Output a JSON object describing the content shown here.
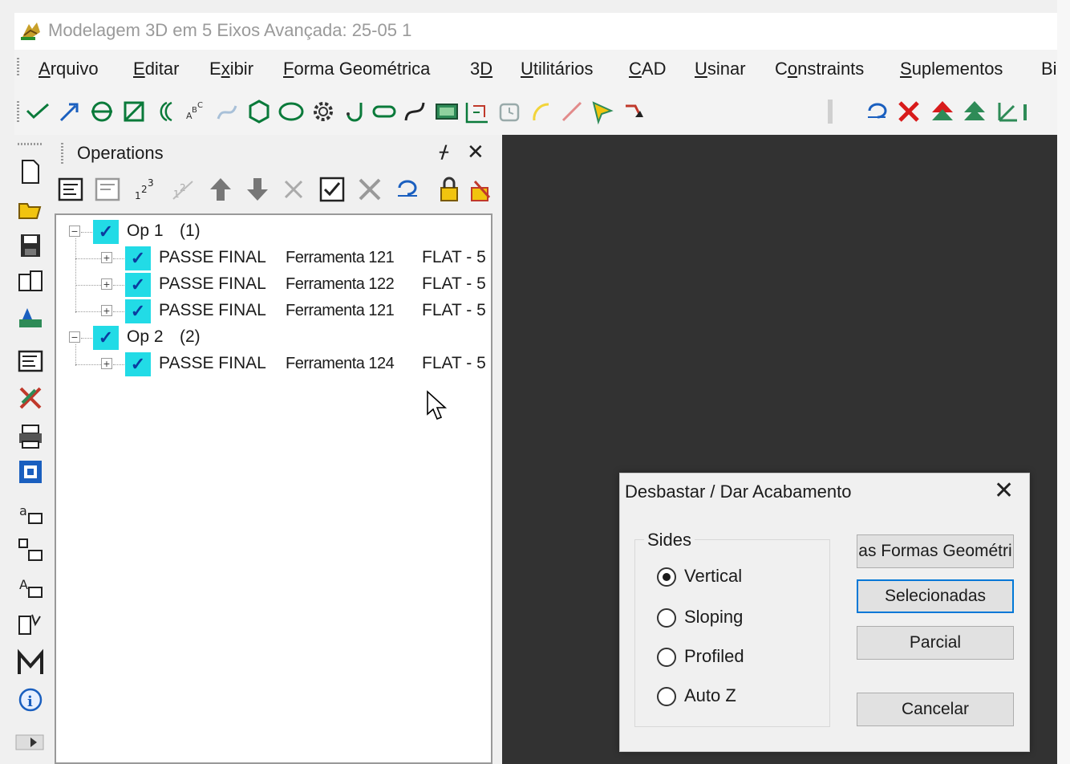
{
  "window": {
    "title": "Modelagem 3D em 5 Eixos Avançada: 25-05 1"
  },
  "menu": [
    {
      "label": "Arquivo",
      "mnemonic": "A",
      "rest": "rquivo"
    },
    {
      "label": "Editar",
      "mnemonic": "E",
      "rest": "ditar"
    },
    {
      "label": "Exibir",
      "pre": "E",
      "mnemonic": "x",
      "rest": "ibir"
    },
    {
      "label": "Forma Geométrica",
      "mnemonic": "F",
      "rest": "orma Geométrica"
    },
    {
      "label": "3D",
      "pre": "3",
      "mnemonic": "D",
      "rest": ""
    },
    {
      "label": "Utilitários",
      "mnemonic": "U",
      "rest": "tilitários"
    },
    {
      "label": "CAD",
      "mnemonic": "C",
      "rest": "AD"
    },
    {
      "label": "Usinar",
      "mnemonic": "U",
      "rest": "sinar"
    },
    {
      "label": "Constraints",
      "pre": "C",
      "mnemonic": "o",
      "rest": "nstraints"
    },
    {
      "label": "Suplementos",
      "mnemonic": "S",
      "rest": "uplementos"
    },
    {
      "label": "Bi",
      "mnemonic": "",
      "rest": "Bi"
    }
  ],
  "operations_panel": {
    "title": "Operations",
    "pin_glyph": "ᚋ",
    "close_glyph": "✕",
    "tree": [
      {
        "label": "Op 1",
        "count": "(1)",
        "children": [
          {
            "name": "PASSE FINAL",
            "tool": "Ferramenta 121",
            "type": "FLAT - 5"
          },
          {
            "name": "PASSE FINAL",
            "tool": "Ferramenta 122",
            "type": "FLAT - 5"
          },
          {
            "name": "PASSE FINAL",
            "tool": "Ferramenta 121",
            "type": "FLAT - 5"
          }
        ]
      },
      {
        "label": "Op 2",
        "count": "(2)",
        "children": [
          {
            "name": "PASSE FINAL",
            "tool": "Ferramenta 124",
            "type": "FLAT - 5"
          }
        ]
      }
    ]
  },
  "dialog": {
    "title": "Desbastar / Dar Acabamento",
    "close_glyph": "✕",
    "group_label": "Sides",
    "options": [
      {
        "label": "Vertical",
        "selected": true
      },
      {
        "label": "Sloping",
        "selected": false
      },
      {
        "label": "Profiled",
        "selected": false
      },
      {
        "label": "Auto Z",
        "selected": false
      }
    ],
    "buttons": {
      "all_shapes": "as Formas Geométri",
      "selected": "Selecionadas",
      "partial": "Parcial",
      "cancel": "Cancelar"
    }
  },
  "colors": {
    "check_bg": "#22dbe6",
    "viewport": "#323232",
    "accent": "#0078d7"
  }
}
